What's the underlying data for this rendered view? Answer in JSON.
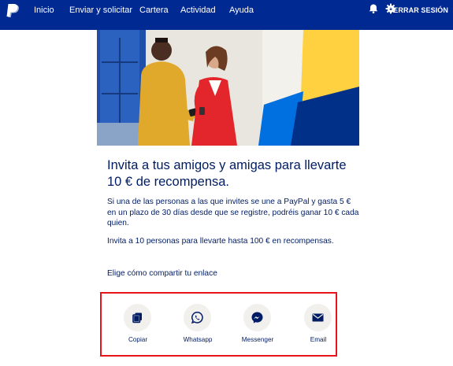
{
  "nav": {
    "logo_icon": "paypal-logo",
    "items": [
      {
        "label": "Inicio"
      },
      {
        "label": "Enviar y solicitar"
      },
      {
        "label": "Cartera"
      },
      {
        "label": "Actividad"
      },
      {
        "label": "Ayuda"
      }
    ],
    "notification_icon": "bell-icon",
    "settings_icon": "gear-icon",
    "logout_label": "CERRAR SESIÓN"
  },
  "promo": {
    "headline": "Invita a tus amigos y amigas para llevarte 10 € de recompensa.",
    "paragraph1": "Si una de las personas a las que invites se une a PayPal y gasta 5 € en un plazo de 30 días desde que se registre, podréis ganar 10 € cada quien.",
    "paragraph2": "Invita a 10 personas para llevarte hasta 100 € en recompensas.",
    "share_prompt": "Elige cómo compartir tu enlace"
  },
  "share_options": [
    {
      "label": "Copiar",
      "icon": "copy-icon"
    },
    {
      "label": "Whatsapp",
      "icon": "whatsapp-icon"
    },
    {
      "label": "Messenger",
      "icon": "messenger-icon"
    },
    {
      "label": "Email",
      "icon": "envelope-icon"
    }
  ],
  "colors": {
    "nav_background": "#002991",
    "text": "#001c64",
    "highlight_border": "#e8141b",
    "icon_circle": "#f2f0ec"
  }
}
